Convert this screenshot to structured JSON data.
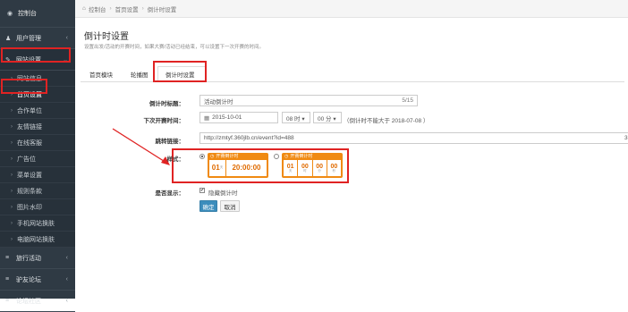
{
  "sidebar": {
    "top": {
      "label": "控制台"
    },
    "sections": [
      {
        "label": "用户管理",
        "arrow": "‹"
      },
      {
        "label": "网站设置",
        "arrow": "⌄"
      }
    ],
    "subitems": [
      {
        "label": "网站信息"
      },
      {
        "label": "首页设置"
      },
      {
        "label": "合作单位"
      },
      {
        "label": "友情链接"
      },
      {
        "label": "在线客服"
      },
      {
        "label": "广告位"
      },
      {
        "label": "菜单设置"
      },
      {
        "label": "规则条款"
      },
      {
        "label": "图片水印"
      },
      {
        "label": "手机网站换肤"
      },
      {
        "label": "电脑网站换肤"
      }
    ],
    "bottom_sections": [
      {
        "label": "旅行活动",
        "arrow": "‹"
      },
      {
        "label": "驴友论坛",
        "arrow": "‹"
      },
      {
        "label": "论坛社区",
        "arrow": "‹"
      }
    ]
  },
  "breadcrumb": {
    "home": "控制台",
    "level1": "首页设置",
    "current": "倒计时设置"
  },
  "page": {
    "title": "倒计时设置",
    "description": "设置出发/活动的开赛时间，如果大赛/活动已经结束，可以设置下一次开赛的时间。"
  },
  "tabs": [
    {
      "label": "首页模块"
    },
    {
      "label": "轮播图"
    },
    {
      "label": "倒计时设置"
    }
  ],
  "form": {
    "title_label": "倒计时标题：",
    "title_value": "活动倒计时",
    "title_count": "5/15",
    "time_label": "下次开赛时间：",
    "date_value": "2015-10-01",
    "hour_value": "08 时 ▾",
    "minute_value": "00 分 ▾",
    "time_note": "（倒计时不能大于 2018-07-08 ）",
    "link_label": "跳转链接：",
    "link_value": "http://zmtyf.360jlb.cn/event?id=488",
    "link_overflow": "3",
    "style_label": "样式：",
    "style1": {
      "header": "开赛倒计时",
      "days": "01",
      "days_unit": "天",
      "time": "20:00:00"
    },
    "style2": {
      "header": "开赛倒计时",
      "days": "01",
      "hours": "00",
      "minutes": "00",
      "seconds": "00",
      "u_day": "天",
      "u_hour": "时",
      "u_min": "分",
      "u_sec": "秒"
    },
    "show_label": "是否显示：",
    "hide_checkbox_mark": "✔",
    "hide_text": "隐藏倒计时",
    "confirm_label": "确定",
    "cancel_label": "取消"
  },
  "colors": {
    "sidebar_bg": "#2f3a44",
    "accent": "#f08a12",
    "highlight": "#e02323",
    "primary": "#3c8dbc"
  }
}
